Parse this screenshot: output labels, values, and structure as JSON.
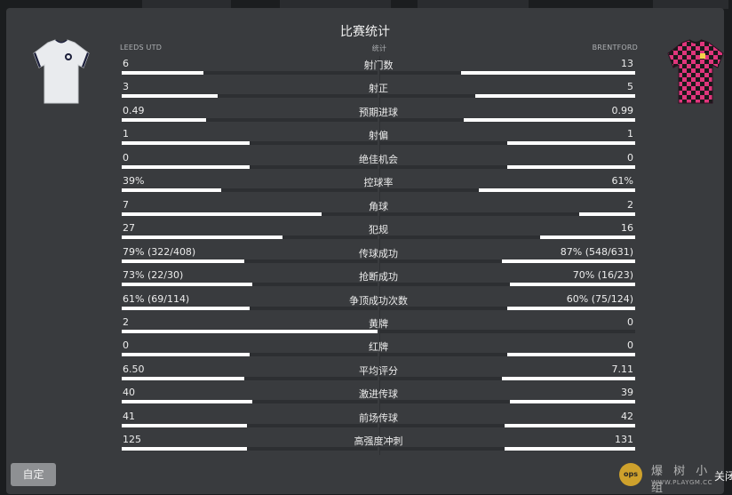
{
  "title": "比赛统计",
  "header": {
    "home_team": "LEEDS UTD",
    "stat_label": "统计",
    "away_team": "BRENTFORD"
  },
  "stats": [
    {
      "label": "射门数",
      "home": "6",
      "away": "13",
      "home_share": 0.32,
      "away_share": 0.68
    },
    {
      "label": "射正",
      "home": "3",
      "away": "5",
      "home_share": 0.375,
      "away_share": 0.625
    },
    {
      "label": "预期进球",
      "home": "0.49",
      "away": "0.99",
      "home_share": 0.33,
      "away_share": 0.67
    },
    {
      "label": "射偏",
      "home": "1",
      "away": "1",
      "home_share": 0.5,
      "away_share": 0.5
    },
    {
      "label": "绝佳机会",
      "home": "0",
      "away": "0",
      "home_share": 0.5,
      "away_share": 0.5
    },
    {
      "label": "控球率",
      "home": "39%",
      "away": "61%",
      "home_share": 0.39,
      "away_share": 0.61
    },
    {
      "label": "角球",
      "home": "7",
      "away": "2",
      "home_share": 0.78,
      "away_share": 0.22
    },
    {
      "label": "犯规",
      "home": "27",
      "away": "16",
      "home_share": 0.63,
      "away_share": 0.37
    },
    {
      "label": "传球成功",
      "home": "79% (322/408)",
      "away": "87% (548/631)",
      "home_share": 0.48,
      "away_share": 0.52
    },
    {
      "label": "抢断成功",
      "home": "73% (22/30)",
      "away": "70% (16/23)",
      "home_share": 0.51,
      "away_share": 0.49
    },
    {
      "label": "争顶成功次数",
      "home": "61% (69/114)",
      "away": "60% (75/124)",
      "home_share": 0.5,
      "away_share": 0.5
    },
    {
      "label": "黄牌",
      "home": "2",
      "away": "0",
      "home_share": 1.0,
      "away_share": 0.0
    },
    {
      "label": "红牌",
      "home": "0",
      "away": "0",
      "home_share": 0.5,
      "away_share": 0.5
    },
    {
      "label": "平均评分",
      "home": "6.50",
      "away": "7.11",
      "home_share": 0.48,
      "away_share": 0.52
    },
    {
      "label": "激进传球",
      "home": "40",
      "away": "39",
      "home_share": 0.51,
      "away_share": 0.49
    },
    {
      "label": "前场传球",
      "home": "41",
      "away": "42",
      "home_share": 0.49,
      "away_share": 0.51
    },
    {
      "label": "高强度冲刺",
      "home": "125",
      "away": "131",
      "home_share": 0.49,
      "away_share": 0.51
    }
  ],
  "buttons": {
    "custom": "自定",
    "close": "关闭"
  },
  "watermark": {
    "text": "爆 树 小 组",
    "url": "WWW.PLAYGM.CC",
    "logo": "ops"
  },
  "colors": {
    "panel": "#393b3e",
    "bar_fill": "#ffffff",
    "away_kit_primary": "#e0357c",
    "away_kit_secondary": "#1a1a1a",
    "home_kit": "#e9ebee"
  }
}
